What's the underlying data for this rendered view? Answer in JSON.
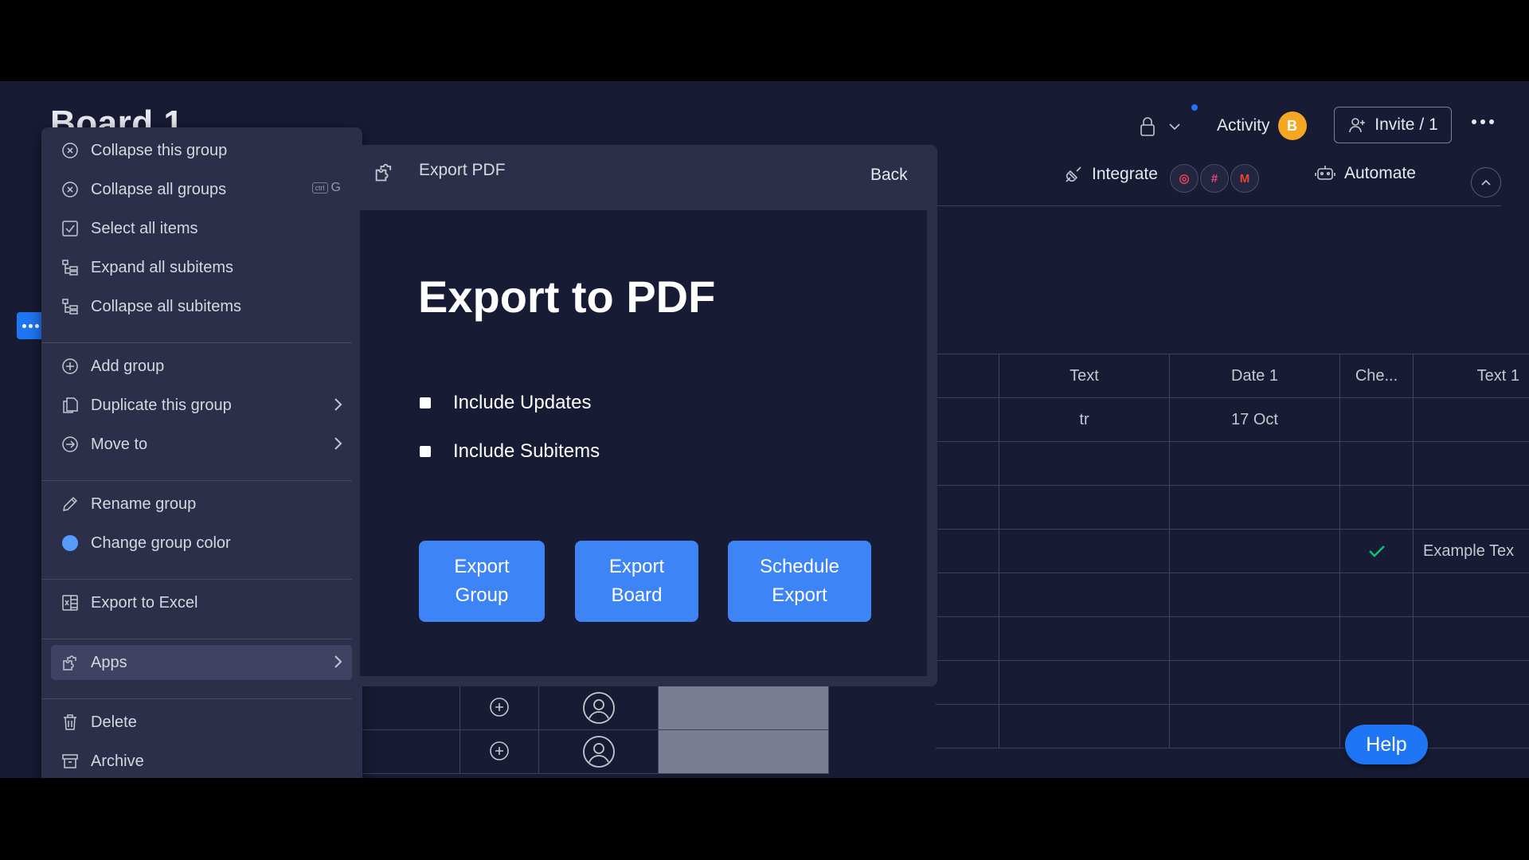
{
  "board": {
    "title": "Board 1"
  },
  "header": {
    "activity_label": "Activity",
    "avatar_initial": "B",
    "invite_label": "Invite / 1",
    "integrate_label": "Integrate",
    "automate_label": "Automate"
  },
  "table": {
    "columns": [
      "Text",
      "Date 1",
      "Che...",
      "Text 1"
    ],
    "row1": {
      "text": "tr",
      "date": "17 Oct"
    },
    "row4": {
      "text1": "Example Tex"
    }
  },
  "menu": {
    "items": [
      {
        "label": "Collapse this group",
        "icon": "collapse-icon"
      },
      {
        "label": "Collapse all groups",
        "icon": "collapse-icon",
        "shortcut": "G"
      },
      {
        "label": "Select all items",
        "icon": "checkbox-icon"
      },
      {
        "label": "Expand all subitems",
        "icon": "subitems-icon"
      },
      {
        "label": "Collapse all subitems",
        "icon": "subitems-icon"
      },
      {
        "label": "Add group",
        "icon": "add-icon"
      },
      {
        "label": "Duplicate this group",
        "icon": "duplicate-icon"
      },
      {
        "label": "Move to",
        "icon": "move-icon"
      },
      {
        "label": "Rename group",
        "icon": "pencil-icon"
      },
      {
        "label": "Change group color",
        "icon": "color-dot-icon"
      },
      {
        "label": "Export to Excel",
        "icon": "excel-icon"
      },
      {
        "label": "Apps",
        "icon": "apps-icon"
      },
      {
        "label": "Delete",
        "icon": "trash-icon"
      },
      {
        "label": "Archive",
        "icon": "archive-icon"
      }
    ],
    "kbd_ctrl": "ctrl"
  },
  "export_panel": {
    "header_title": "Export PDF",
    "back_label": "Back",
    "title": "Export to PDF",
    "include_updates": "Include Updates",
    "include_subitems": "Include Subitems",
    "buttons": [
      "Export\nGroup",
      "Export\nBoard",
      "Schedule\nExport"
    ]
  },
  "help_label": "Help",
  "colors": {
    "background": "#181b34",
    "menu_bg": "#2b2f4a",
    "primary_blue": "#3d84f7",
    "group_color": "#579bfc",
    "check_green": "#00c875",
    "avatar_orange": "#f5a623"
  }
}
